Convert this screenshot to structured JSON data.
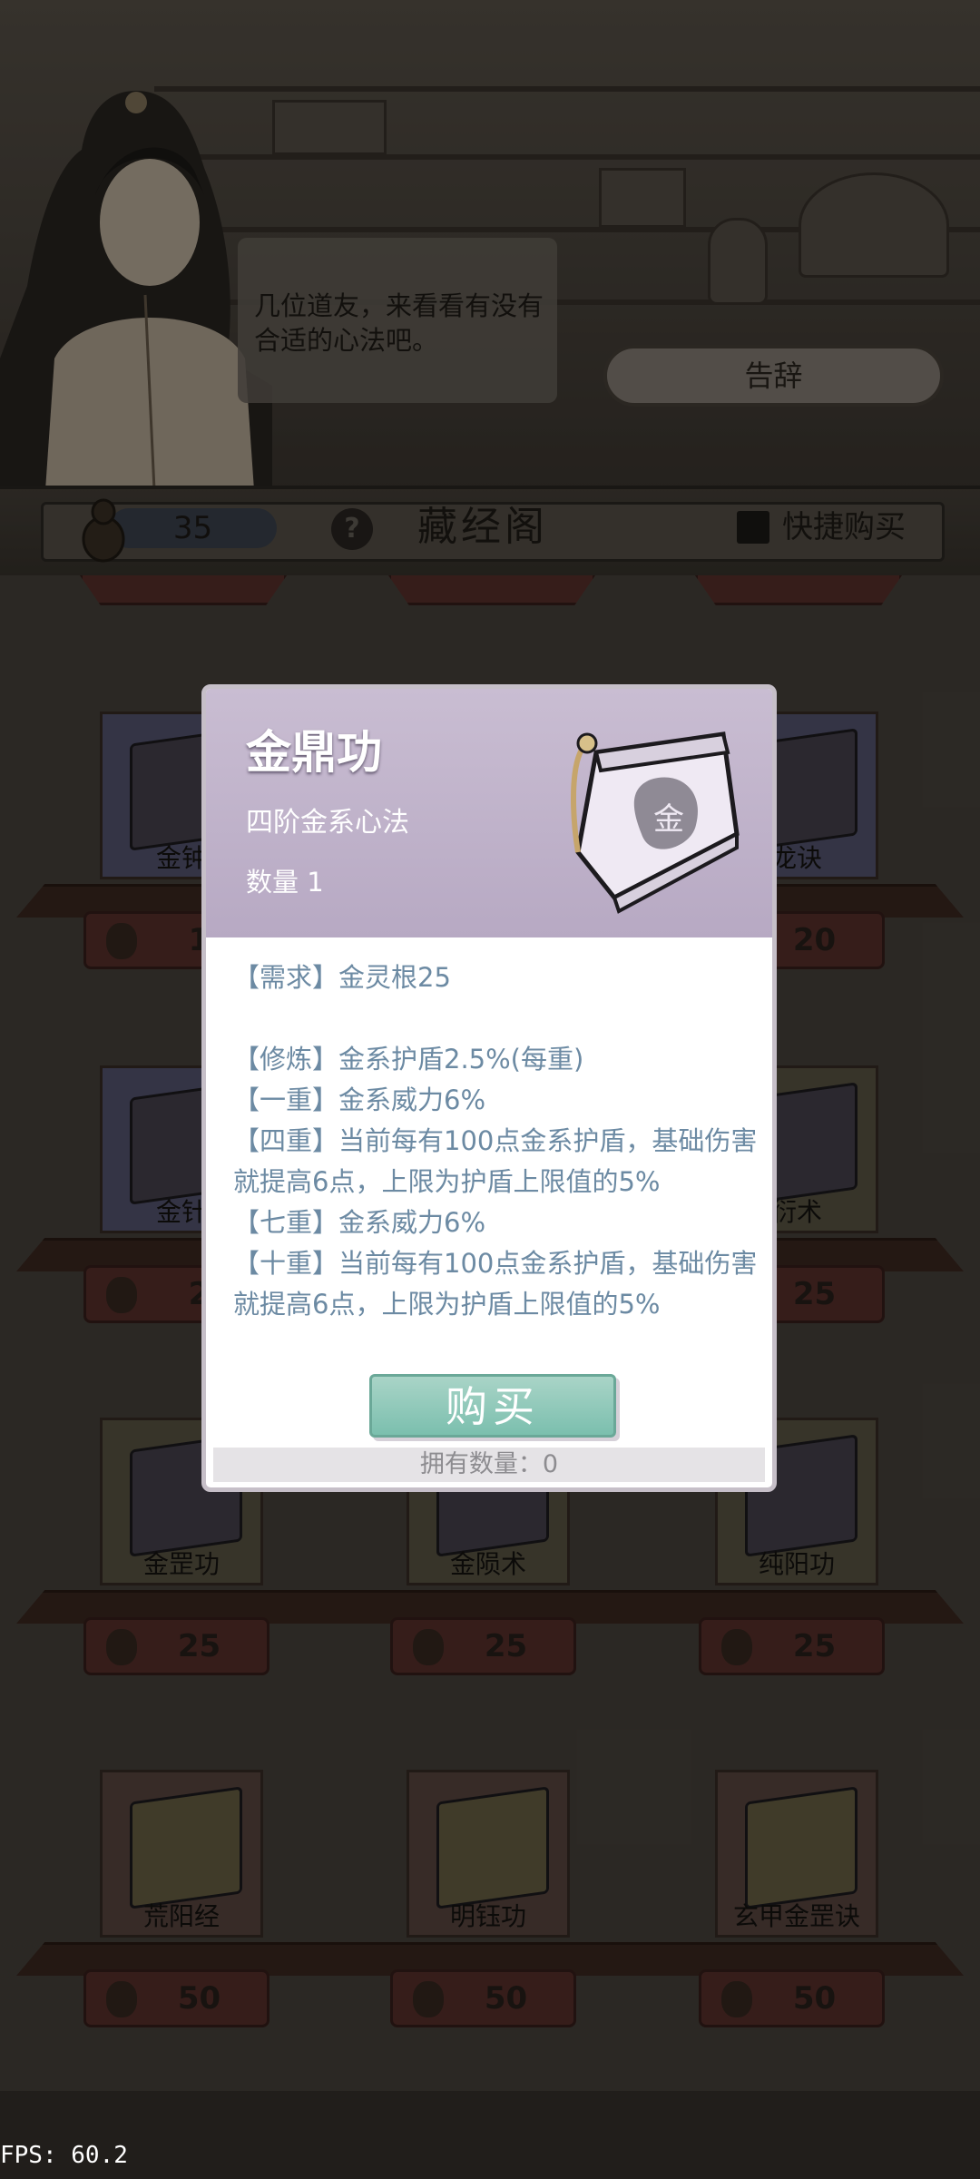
{
  "npc": {
    "dialogue": "几位道友，来看看有没有合适的心法吧。",
    "farewell_label": "告辞"
  },
  "toolbar": {
    "coin_count": "35",
    "help_label": "?",
    "title": "藏经阁",
    "quick_buy_label": "快捷购买"
  },
  "shop": {
    "rows": [
      {
        "items": [
          {
            "name": "金钟",
            "price": "1"
          },
          {
            "name": "",
            "price": ""
          },
          {
            "name": "龙诀",
            "price": "20"
          }
        ]
      },
      {
        "items": [
          {
            "name": "金针",
            "price": "2"
          },
          {
            "name": "",
            "price": ""
          },
          {
            "name": "衍术",
            "price": "25"
          }
        ]
      },
      {
        "items": [
          {
            "name": "金罡功",
            "price": "25"
          },
          {
            "name": "金陨术",
            "price": "25"
          },
          {
            "name": "纯阳功",
            "price": "25"
          }
        ]
      },
      {
        "items": [
          {
            "name": "荒阳经",
            "price": "50"
          },
          {
            "name": "明钰功",
            "price": "50"
          },
          {
            "name": "玄甲金罡诀",
            "price": "50"
          }
        ]
      }
    ]
  },
  "modal": {
    "title": "金鼎功",
    "subtitle": "四阶金系心法",
    "count": "数量 1",
    "book_glyph": "金",
    "lines": [
      "【需求】金灵根25",
      "",
      "【修炼】金系护盾2.5%(每重)",
      "【一重】金系威力6%",
      "【四重】当前每有100点金系护盾，基础伤害就提高6点，上限为护盾上限值的5%",
      "【七重】金系威力6%",
      "【十重】当前每有100点金系护盾，基础伤害就提高6点，上限为护盾上限值的5%"
    ],
    "buy_label": "购买",
    "owned_label": "拥有数量：0"
  },
  "fps": "FPS: 60.2",
  "colors": {
    "modal_header": "#c9bdd2",
    "buy_button": "#7bbfae",
    "effect_text": "#6c8aa3"
  }
}
